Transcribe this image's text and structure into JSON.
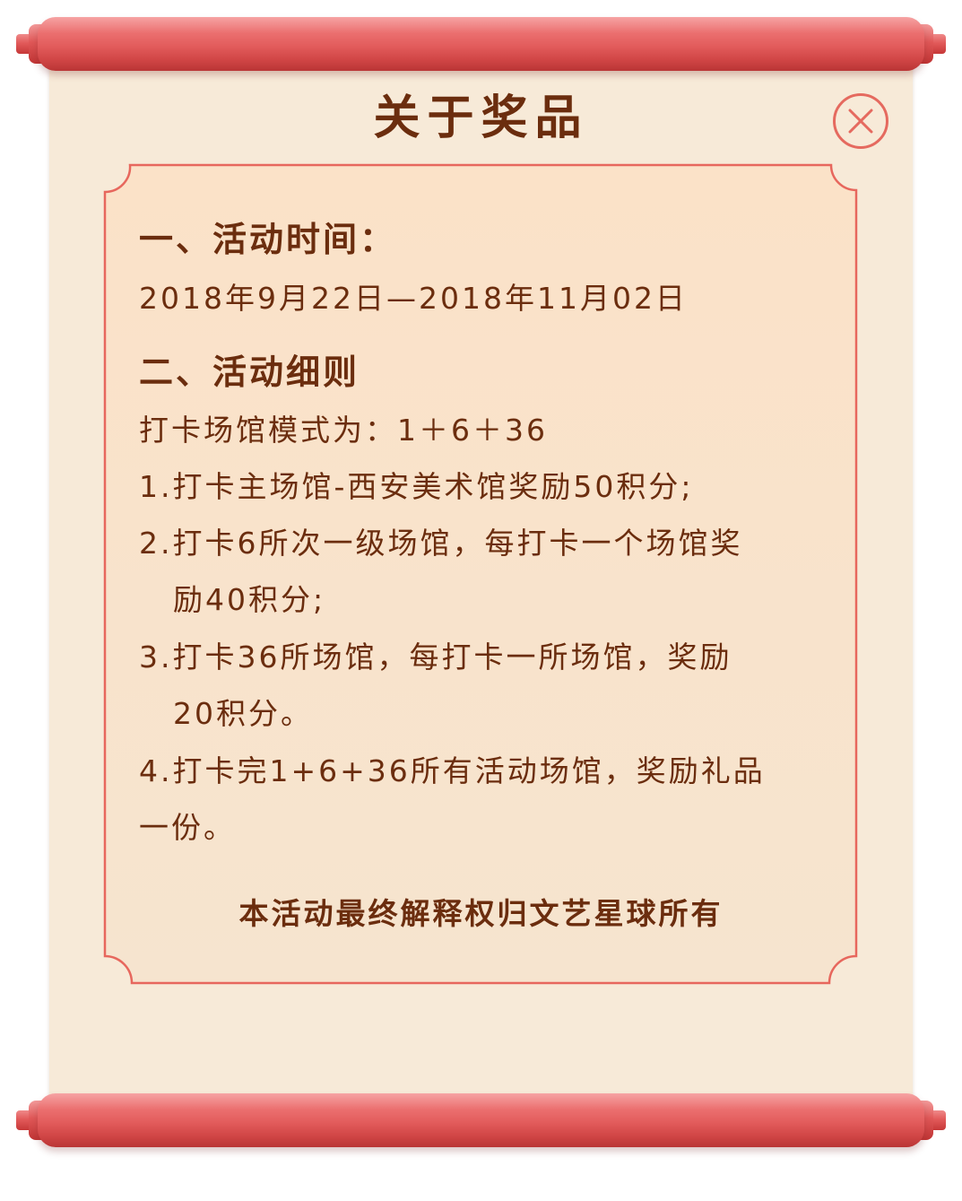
{
  "dialog": {
    "title": "关于奖品",
    "close_icon": "close-icon",
    "section1": {
      "heading": "一、活动时间：",
      "date_range": "2018年9月22日—2018年11月02日"
    },
    "section2": {
      "heading": "二、活动细则",
      "mode": "打卡场馆模式为：1＋6＋36",
      "rules": [
        {
          "line1": "1.打卡主场馆-西安美术馆奖励50积分;"
        },
        {
          "line1": "2.打卡6所次一级场馆，每打卡一个场馆奖",
          "line2": "励40积分;"
        },
        {
          "line1": "3.打卡36所场馆，每打卡一所场馆，奖励",
          "line2": "20积分。"
        },
        {
          "line1": "4.打卡完1+6+36所有活动场馆，奖励礼品",
          "line2": "一份。"
        }
      ]
    },
    "footer": "本活动最终解释权归文艺星球所有"
  },
  "colors": {
    "text": "#6b2d0e",
    "paper": "#f7ead8",
    "frame_border": "#e7675d",
    "roller": "#e25b5b",
    "close": "#e56a5f"
  }
}
